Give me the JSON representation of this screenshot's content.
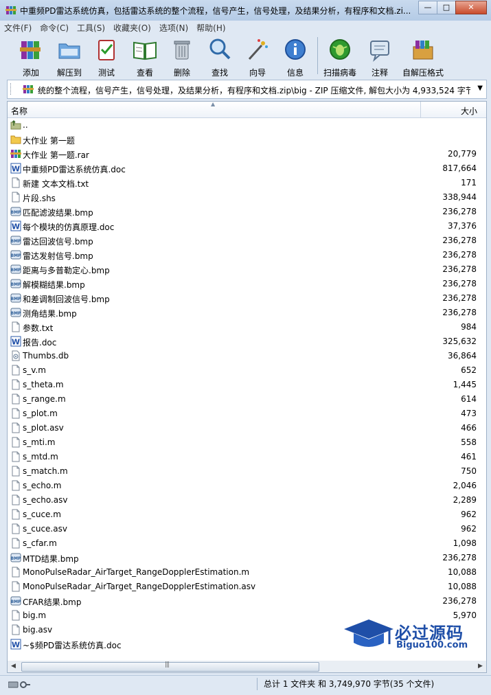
{
  "window": {
    "title": "中重频PD雷达系统仿真，包括雷达系统的整个流程，信号产生，信号处理，及结果分析，有程序和文档.zi...",
    "minimize": "—",
    "maximize": "□",
    "close": "✕"
  },
  "menu": [
    "文件(F)",
    "命令(C)",
    "工具(S)",
    "收藏夹(O)",
    "选项(N)",
    "帮助(H)"
  ],
  "toolbar": [
    {
      "label": "添加",
      "icon": "add-archive-icon"
    },
    {
      "label": "解压到",
      "icon": "extract-to-icon"
    },
    {
      "label": "测试",
      "icon": "test-icon"
    },
    {
      "label": "查看",
      "icon": "view-icon"
    },
    {
      "label": "删除",
      "icon": "delete-icon"
    },
    {
      "label": "查找",
      "icon": "find-icon"
    },
    {
      "label": "向导",
      "icon": "wizard-icon"
    },
    {
      "label": "信息",
      "icon": "info-icon"
    },
    {
      "label": "扫描病毒",
      "icon": "virus-scan-icon"
    },
    {
      "label": "注释",
      "icon": "comment-icon"
    },
    {
      "label": "自解压格式",
      "icon": "sfx-icon"
    }
  ],
  "path": "统的整个流程，信号产生，信号处理，及结果分析，有程序和文档.zip\\big - ZIP 压缩文件, 解包大小为 4,933,524 字节",
  "columns": {
    "name": "名称",
    "size": "大小"
  },
  "files": [
    {
      "name": "..",
      "size": "",
      "type": "up"
    },
    {
      "name": "大作业 第一题",
      "size": "",
      "type": "folder"
    },
    {
      "name": "大作业 第一题.rar",
      "size": "20,779",
      "type": "rar"
    },
    {
      "name": "中重频PD雷达系统仿真.doc",
      "size": "817,664",
      "type": "doc"
    },
    {
      "name": "新建 文本文档.txt",
      "size": "171",
      "type": "txt"
    },
    {
      "name": "片段.shs",
      "size": "338,944",
      "type": "txt"
    },
    {
      "name": "匹配滤波结果.bmp",
      "size": "236,278",
      "type": "bmp"
    },
    {
      "name": "每个模块的仿真原理.doc",
      "size": "37,376",
      "type": "doc"
    },
    {
      "name": "雷达回波信号.bmp",
      "size": "236,278",
      "type": "bmp"
    },
    {
      "name": "雷达发射信号.bmp",
      "size": "236,278",
      "type": "bmp"
    },
    {
      "name": "距离与多普勒定心.bmp",
      "size": "236,278",
      "type": "bmp"
    },
    {
      "name": "解模糊结果.bmp",
      "size": "236,278",
      "type": "bmp"
    },
    {
      "name": "和差调制回波信号.bmp",
      "size": "236,278",
      "type": "bmp"
    },
    {
      "name": "测角结果.bmp",
      "size": "236,278",
      "type": "bmp"
    },
    {
      "name": "参数.txt",
      "size": "984",
      "type": "txt"
    },
    {
      "name": "报告.doc",
      "size": "325,632",
      "type": "doc"
    },
    {
      "name": "Thumbs.db",
      "size": "36,864",
      "type": "db"
    },
    {
      "name": "s_v.m",
      "size": "652",
      "type": "txt"
    },
    {
      "name": "s_theta.m",
      "size": "1,445",
      "type": "txt"
    },
    {
      "name": "s_range.m",
      "size": "614",
      "type": "txt"
    },
    {
      "name": "s_plot.m",
      "size": "473",
      "type": "txt"
    },
    {
      "name": "s_plot.asv",
      "size": "466",
      "type": "txt"
    },
    {
      "name": "s_mti.m",
      "size": "558",
      "type": "txt"
    },
    {
      "name": "s_mtd.m",
      "size": "461",
      "type": "txt"
    },
    {
      "name": "s_match.m",
      "size": "750",
      "type": "txt"
    },
    {
      "name": "s_echo.m",
      "size": "2,046",
      "type": "txt"
    },
    {
      "name": "s_echo.asv",
      "size": "2,289",
      "type": "txt"
    },
    {
      "name": "s_cuce.m",
      "size": "962",
      "type": "txt"
    },
    {
      "name": "s_cuce.asv",
      "size": "962",
      "type": "txt"
    },
    {
      "name": "s_cfar.m",
      "size": "1,098",
      "type": "txt"
    },
    {
      "name": "MTD结果.bmp",
      "size": "236,278",
      "type": "bmp"
    },
    {
      "name": "MonoPulseRadar_AirTarget_RangeDopplerEstimation.m",
      "size": "10,088",
      "type": "txt"
    },
    {
      "name": "MonoPulseRadar_AirTarget_RangeDopplerEstimation.asv",
      "size": "10,088",
      "type": "txt"
    },
    {
      "name": "CFAR结果.bmp",
      "size": "236,278",
      "type": "bmp"
    },
    {
      "name": "big.m",
      "size": "5,970",
      "type": "txt"
    },
    {
      "name": "big.asv",
      "size": "",
      "type": "txt"
    },
    {
      "name": "~$频PD雷达系统仿真.doc",
      "size": "",
      "type": "doc"
    }
  ],
  "status": "总计 1 文件夹 和 3,749,970 字节(35 个文件)",
  "watermark": {
    "title": "必过源码",
    "sub": "Biguo100.com"
  },
  "colors": {
    "accent": "#1f4fa8",
    "window_bg": "#dfe8f3"
  }
}
